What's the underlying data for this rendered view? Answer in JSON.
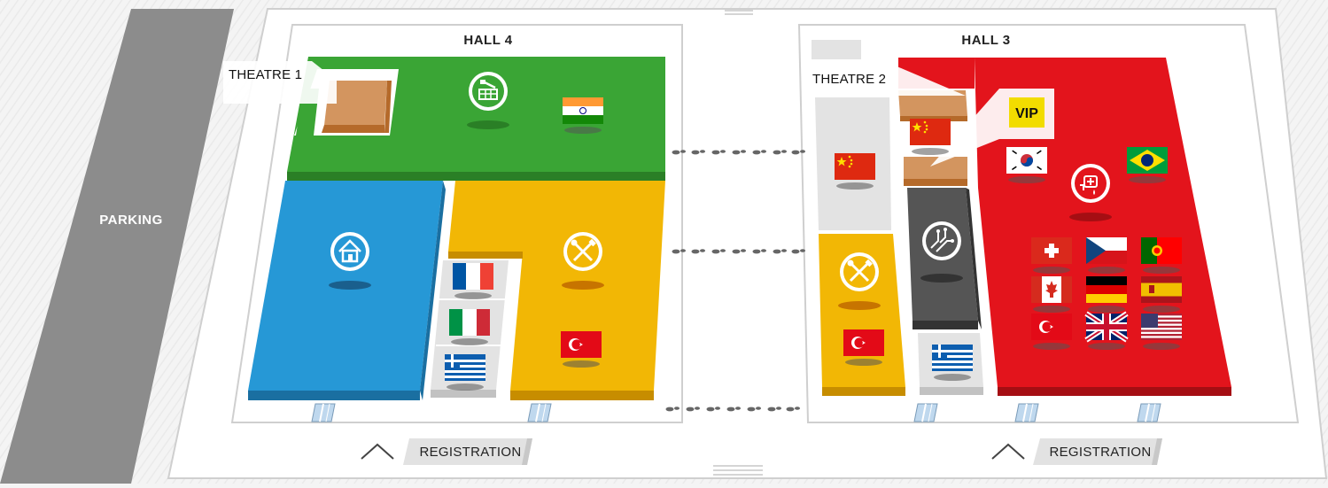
{
  "parking": {
    "label": "PARKING"
  },
  "halls": [
    {
      "title": "HALL 4"
    },
    {
      "title": "HALL 3"
    }
  ],
  "theatres": [
    {
      "label": "THEATRE 1"
    },
    {
      "label": "THEATRE 2"
    }
  ],
  "vip": {
    "label": "VIP"
  },
  "registration": [
    {
      "label": "REGISTRATION"
    },
    {
      "label": "REGISTRATION"
    }
  ],
  "zones": {
    "hall4_green": {
      "color": "#3aa535",
      "icon": "craft-cubes-icon",
      "flags": [
        "india"
      ]
    },
    "hall4_blue": {
      "color": "#2698d6",
      "icon": "home-icon",
      "flags": []
    },
    "hall4_yellow": {
      "color": "#f2b705",
      "icon": "tools-icon",
      "flags": [
        "turkey"
      ]
    },
    "hall4_grey": {
      "color": "#e3e3e3",
      "icon": "",
      "flags": [
        "france",
        "italy",
        "greece"
      ]
    },
    "hall3_lightgrey": {
      "color": "#e3e3e3",
      "icon": "",
      "flags": [
        "china"
      ]
    },
    "hall3_yellow": {
      "color": "#f2b705",
      "icon": "tools-icon",
      "flags": [
        "turkey"
      ]
    },
    "hall3_theatre": {
      "color": "#d3955f",
      "icon": "",
      "flags": [
        "china"
      ]
    },
    "hall3_darkgrey": {
      "color": "#555555",
      "icon": "circuit-icon",
      "flags": []
    },
    "hall3_grey": {
      "color": "#e3e3e3",
      "icon": "",
      "flags": [
        "greece"
      ]
    },
    "hall3_red": {
      "color": "#e3141c",
      "icon": "beauty-care-icon",
      "flags": [
        "south-korea",
        "brazil",
        "switzerland",
        "czech-republic",
        "portugal",
        "canada",
        "germany",
        "spain",
        "turkey",
        "united-kingdom",
        "united-states"
      ]
    }
  },
  "colors": {
    "green": "#3aa535",
    "blue": "#2698d6",
    "yellow": "#f2b705",
    "red": "#e3141c",
    "dark_grey": "#555555",
    "light_grey": "#e3e3e3",
    "theatre_brown": "#d3955f",
    "parking_grey": "#8c8c8c",
    "vip_yellow": "#f2dc00"
  }
}
